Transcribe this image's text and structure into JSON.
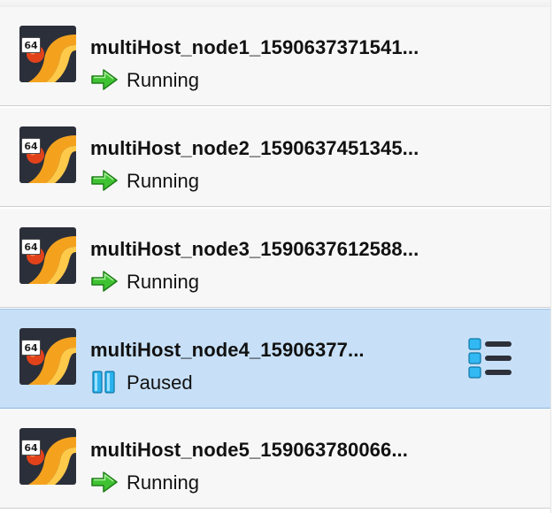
{
  "vm_list": {
    "items": [
      {
        "name": "multiHost_node1_1590637371541...",
        "arch": "64",
        "state": "Running",
        "state_icon": "running-arrow-icon",
        "selected": false
      },
      {
        "name": "multiHost_node2_1590637451345...",
        "arch": "64",
        "state": "Running",
        "state_icon": "running-arrow-icon",
        "selected": false
      },
      {
        "name": "multiHost_node3_1590637612588...",
        "arch": "64",
        "state": "Running",
        "state_icon": "running-arrow-icon",
        "selected": false
      },
      {
        "name": "multiHost_node4_15906377...",
        "arch": "64",
        "state": "Paused",
        "state_icon": "paused-icon",
        "selected": true
      },
      {
        "name": "multiHost_node5_159063780066...",
        "arch": "64",
        "state": "Running",
        "state_icon": "running-arrow-icon",
        "selected": false
      }
    ],
    "os_icon": "linux-64bit-os-icon",
    "details_icon": "machine-tools-menu-icon"
  },
  "colors": {
    "row_background": "#f7f7f7",
    "selected_background": "#c7e0f7",
    "running_green": "#3fc232",
    "paused_blue": "#2bb3ee",
    "os_icon_dark": "#2b2f3a",
    "os_icon_orange": "#f4a21e",
    "os_icon_red": "#e2421a"
  }
}
